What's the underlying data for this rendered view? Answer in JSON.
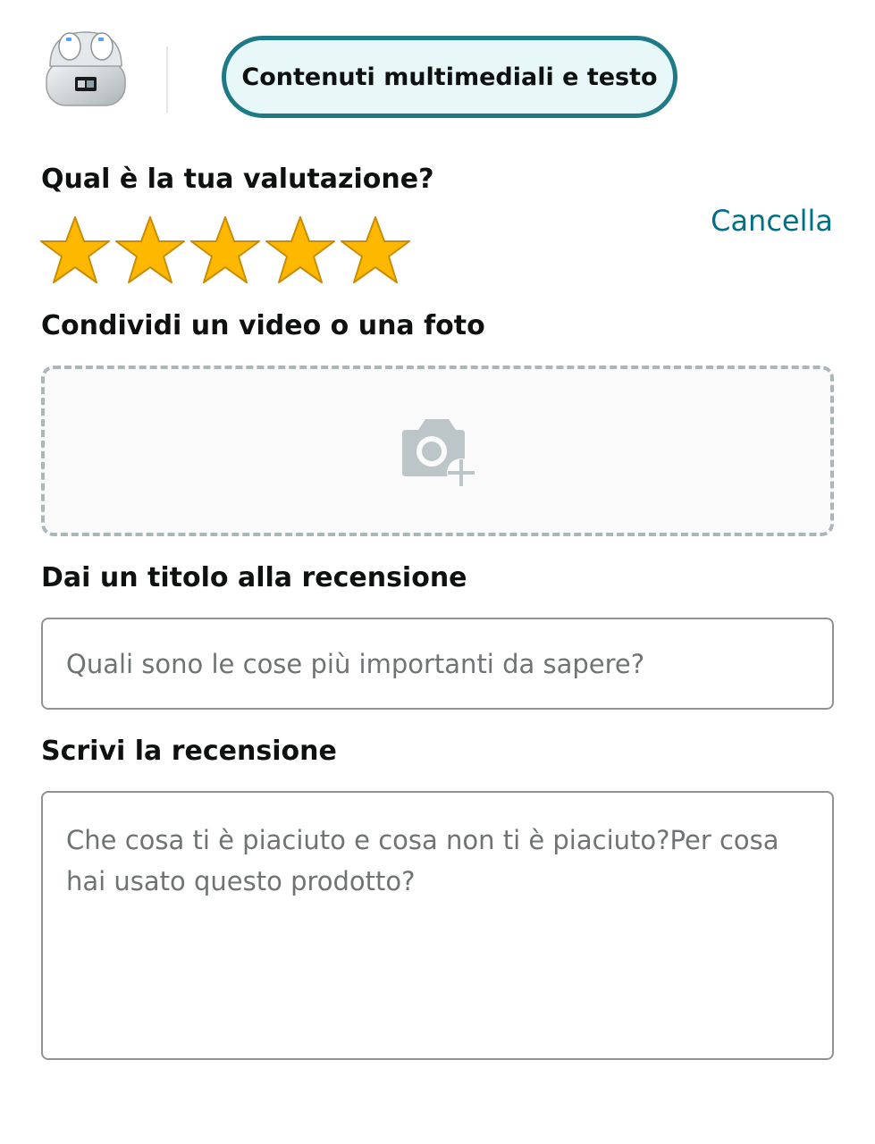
{
  "header": {
    "product_thumbnail_icon": "earbuds-case-icon",
    "tab_label": "Contenuti multimediali e testo"
  },
  "rating": {
    "question": "Qual è la tua valutazione?",
    "clear_label": "Cancella",
    "value": 5,
    "max": 5,
    "star_color": "#ffb800"
  },
  "media": {
    "label": "Condividi un video o una foto",
    "upload_icon": "camera-plus-icon"
  },
  "title": {
    "label": "Dai un titolo alla recensione",
    "placeholder": "Quali sono le cose più importanti da sapere?",
    "value": ""
  },
  "review": {
    "label": "Scrivi la recensione",
    "placeholder": "Che cosa ti è piaciuto e cosa non ti è piaciuto?Per cosa hai usato questo prodotto?",
    "value": ""
  },
  "colors": {
    "accent": "#1e7a86",
    "link": "#007185"
  }
}
